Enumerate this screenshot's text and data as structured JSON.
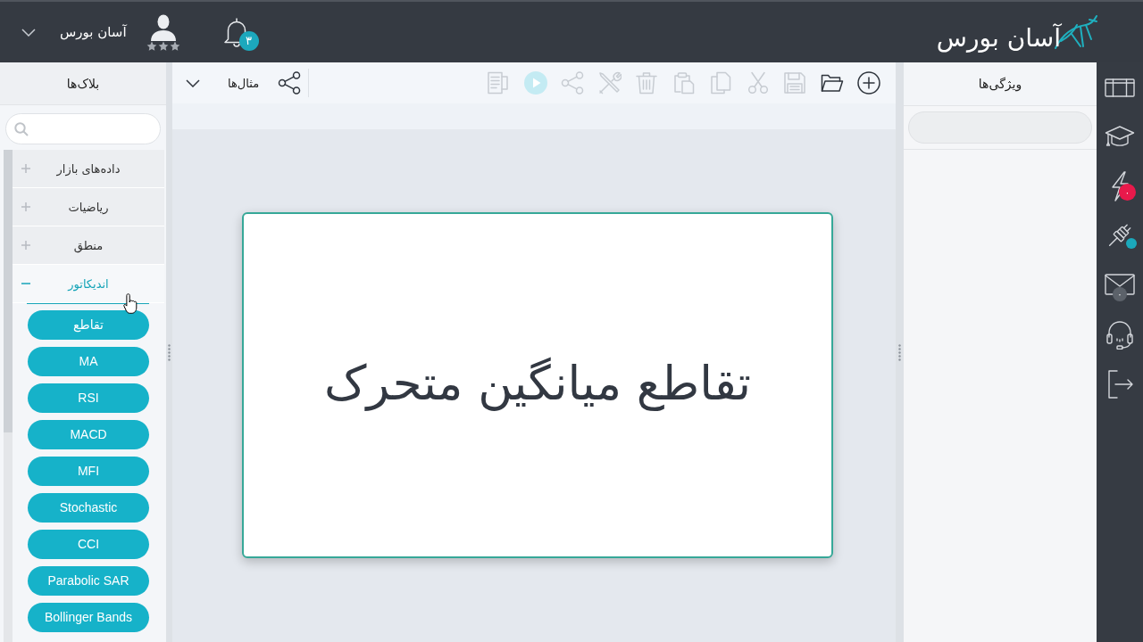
{
  "header": {
    "logo": "آسان بورس",
    "notification_count": "۳",
    "user_name": "آسان بورس"
  },
  "side_nav": [
    {
      "kind": "layout"
    },
    {
      "kind": "course"
    },
    {
      "kind": "signals",
      "badge": "۰",
      "color": "#e8194b"
    },
    {
      "kind": "plugin",
      "color": "#1ba8bb"
    },
    {
      "kind": "mail",
      "badge": "۰",
      "color": "#5c626a"
    },
    {
      "kind": "support"
    },
    {
      "kind": "logout"
    }
  ],
  "properties_panel": {
    "title": "ویژگی‌ها"
  },
  "toolbar": {
    "tools": [
      {
        "kind": "add",
        "disabled": false
      },
      {
        "kind": "open",
        "disabled": false
      },
      {
        "kind": "save",
        "disabled": true
      },
      {
        "kind": "cut",
        "disabled": true
      },
      {
        "kind": "copy",
        "disabled": true
      },
      {
        "kind": "paste",
        "disabled": true
      },
      {
        "kind": "delete",
        "disabled": true
      },
      {
        "kind": "tools",
        "disabled": true
      },
      {
        "kind": "share",
        "disabled": true
      },
      {
        "kind": "run",
        "disabled": true
      },
      {
        "kind": "report",
        "disabled": true
      }
    ],
    "left_tools": [
      {
        "kind": "share",
        "disabled": false
      }
    ],
    "examples_label": "مثال‌ها"
  },
  "canvas": {
    "block": {
      "title": "تقاطع میانگین متحرک"
    }
  },
  "blocks_panel": {
    "title": "بلاک‌ها",
    "categories": [
      {
        "label": "داده‌های بازار",
        "expanded": false
      },
      {
        "label": "ریاضیات",
        "expanded": false
      },
      {
        "label": "منطق",
        "expanded": false
      },
      {
        "label": "اندیکاتور",
        "expanded": true,
        "children": [
          {
            "label": "تقاطع"
          },
          {
            "label": "MA"
          },
          {
            "label": "RSI"
          },
          {
            "label": "MACD"
          },
          {
            "label": "MFI"
          },
          {
            "label": "Stochastic"
          },
          {
            "label": "CCI"
          },
          {
            "label": "Parabolic SAR"
          },
          {
            "label": "Bollinger Bands"
          }
        ]
      }
    ]
  }
}
